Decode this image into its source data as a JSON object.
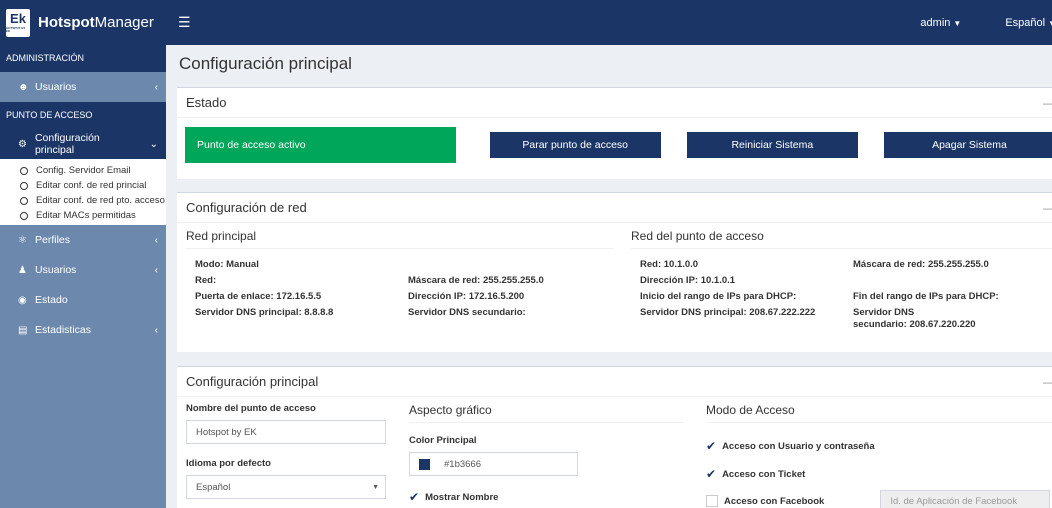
{
  "topbar": {
    "logo_letters": "Ek",
    "logo_sub": "HOTSPOT BY EK",
    "app_name_bold": "Hotspot",
    "app_name_rest": "Manager",
    "menu_icon": "hamburger-icon",
    "user": "admin",
    "language": "Español"
  },
  "sidebar": {
    "section_admin": "ADMINISTRACIÓN",
    "usuarios_admin": "Usuarios",
    "section_ap": "PUNTO DE ACCESO",
    "config_principal": "Configuración principal",
    "submenu": [
      "Config. Servidor Email",
      "Editar conf. de red princial",
      "Editar conf. de red pto. acceso",
      "Editar MACs permitidas"
    ],
    "perfiles": "Perfiles",
    "usuarios": "Usuarios",
    "estado": "Estado",
    "estadisticas": "Estadisticas"
  },
  "main": {
    "title": "Configuración principal",
    "estado": {
      "header": "Estado",
      "status": "Punto de acceso activo",
      "stop_button": "Parar punto de acceso",
      "restart_button": "Reiniciar Sistema",
      "shutdown_button": "Apagar Sistema"
    },
    "red": {
      "header": "Configuración de red",
      "principal_title": "Red principal",
      "principal": {
        "modo": "Modo: Manual",
        "red": "Red:",
        "mascara": "Máscara de red: 255.255.255.0",
        "puerta": "Puerta de enlace: 172.16.5.5",
        "ip": "Dirección IP: 172.16.5.200",
        "dns1": "Servidor DNS principal: 8.8.8.8",
        "dns2": "Servidor DNS secundario:"
      },
      "ap_title": "Red del punto de acceso",
      "ap": {
        "red": "Red: 10.1.0.0",
        "mascara": "Máscara de red: 255.255.255.0",
        "ip": "Dirección IP: 10.1.0.1",
        "inicio": "Inicio del rango de IPs para DHCP:",
        "fin": "Fin del rango de IPs para DHCP:",
        "dns1": "Servidor DNS principal: 208.67.222.222",
        "dns2_line1": "Servidor DNS",
        "dns2_line2": "secundario: 208.67.220.220"
      }
    },
    "config": {
      "header": "Configuración principal",
      "ap_name_label": "Nombre del punto de acceso",
      "ap_name_value": "Hotspot by EK",
      "lang_label": "Idioma por defecto",
      "lang_value": "Español",
      "aspect_title": "Aspecto gráfico",
      "color_label": "Color Principal",
      "color_value": "#1b3666",
      "show_name": "Mostrar Nombre",
      "mode_title": "Modo de Acceso",
      "mode_user": "Acceso con Usuario y contraseña",
      "mode_ticket": "Acceso con Ticket",
      "mode_facebook": "Acceso con Facebook",
      "fb_placeholder": "Id. de Aplicación de Facebook"
    }
  },
  "colors": {
    "brand": "#1b3666",
    "sidebar": "#6c89ad",
    "success": "#00a65a",
    "background": "#ecf0f5"
  }
}
